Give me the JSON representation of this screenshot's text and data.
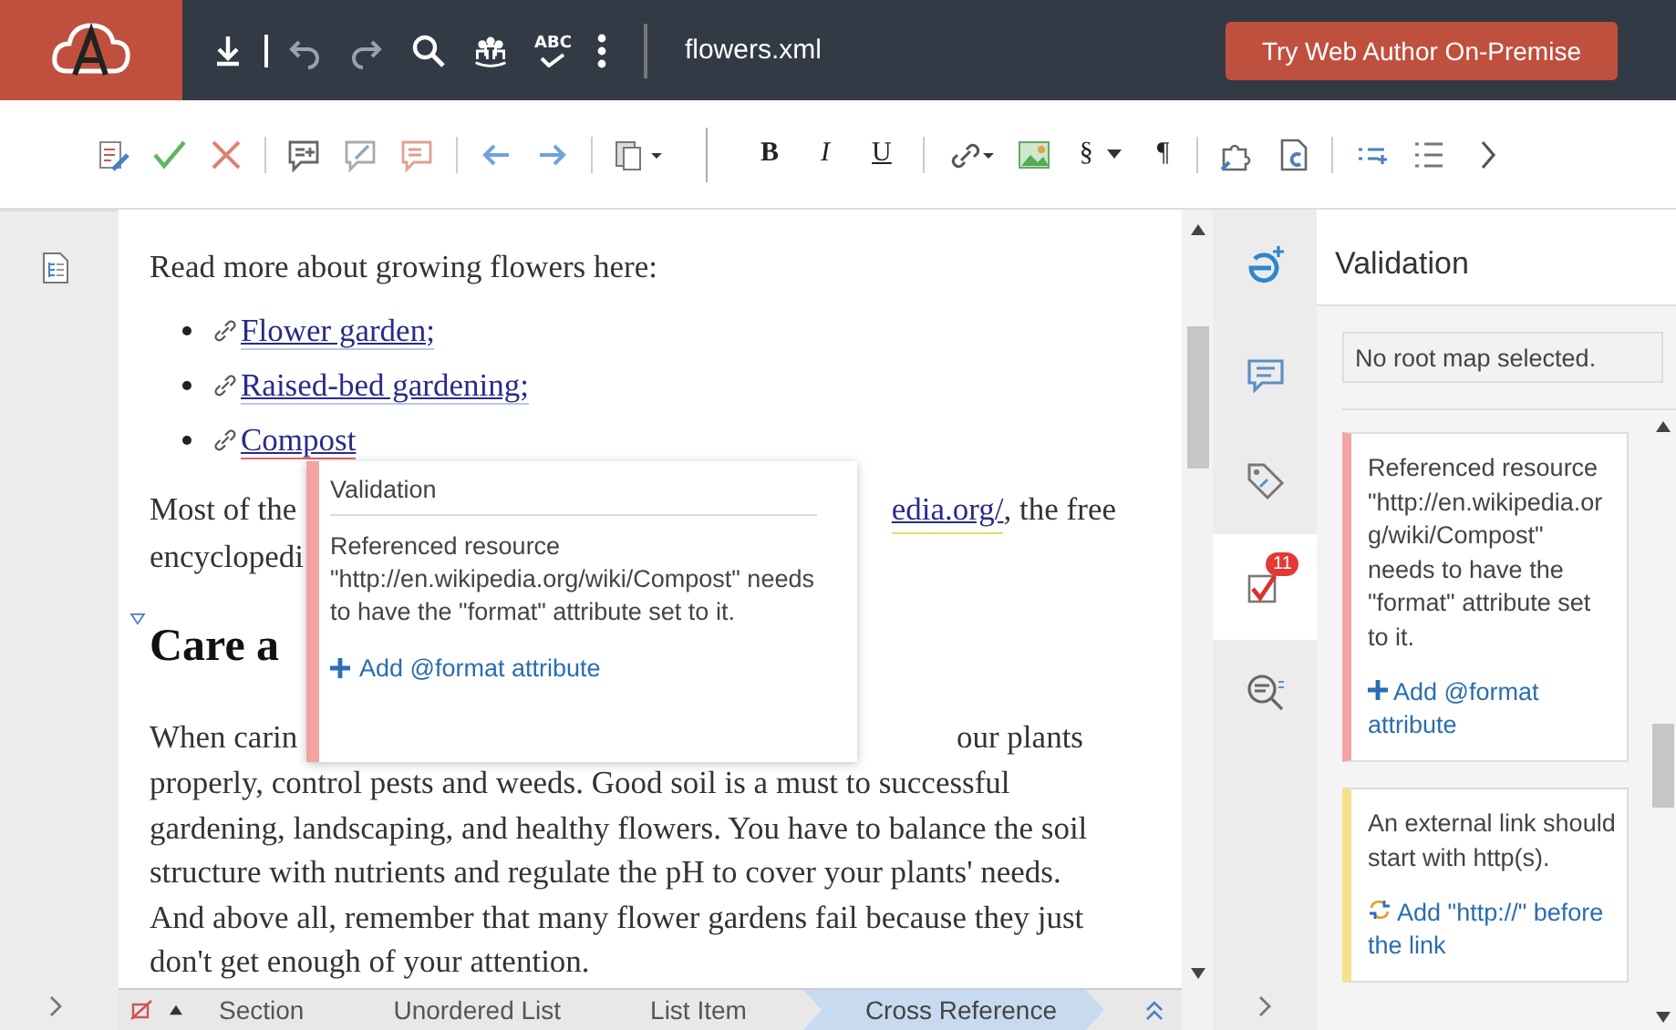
{
  "top_bar": {
    "spell_label": "ABC",
    "file_name": "flowers.xml",
    "try_button": "Try Web Author On-Premise"
  },
  "toolbar": {
    "format_buttons": [
      {
        "label": "B",
        "kind": "bold"
      },
      {
        "label": "I",
        "kind": "italic"
      },
      {
        "label": "U",
        "kind": "underline"
      }
    ],
    "section_label": "§",
    "pilcrow_label": "¶"
  },
  "document": {
    "intro": "Read more about growing flowers here:",
    "links": [
      {
        "label": "Flower garden;",
        "error": false
      },
      {
        "label": "Raised-bed gardening;",
        "error": false
      },
      {
        "label": "Compost",
        "error": true
      }
    ],
    "paragraph_left": [
      "Most of the",
      "encyclopedi"
    ],
    "paragraph_link": "edia.org/",
    "paragraph_right": ", the free",
    "heading": "Care a",
    "care_first_left": "When carin",
    "care_first_right": "our plants",
    "care_lines": [
      "properly, control pests and weeds. Good soil is a must to successful",
      "gardening, landscaping, and healthy flowers. You have to balance the soil",
      "structure with nutrients and regulate the pH to cover your plants' needs.",
      "And above all, remember that many flower gardens fail because they just",
      "don't get enough of your attention."
    ]
  },
  "popup": {
    "title": "Validation",
    "message": "Referenced resource \"http://en.wikipedia.org/wiki/Compost\" needs to have the \"format\" attribute set to it.",
    "action": "Add @format attribute",
    "color": "#f4a3a3"
  },
  "breadcrumb": [
    {
      "label": "Section",
      "selected": false
    },
    {
      "label": "Unordered List",
      "selected": false
    },
    {
      "label": "List Item",
      "selected": false
    },
    {
      "label": "Cross Reference",
      "selected": true
    }
  ],
  "side_tabs": [
    {
      "kind": "add",
      "selected": false
    },
    {
      "kind": "comments",
      "selected": false
    },
    {
      "kind": "tags",
      "selected": false
    },
    {
      "kind": "validation",
      "selected": true,
      "badge": "11"
    },
    {
      "kind": "find",
      "selected": false
    }
  ],
  "validation_panel": {
    "title": "Validation",
    "root_map_field": {
      "value": "No root map selected."
    },
    "messages": [
      {
        "color": "#f4a3a3",
        "text": "Referenced resource \"http://en.wikipedia.org/wiki/Compost\" needs to have the \"format\" attribute set to it.",
        "action": "Add @format attribute",
        "kind": "add"
      },
      {
        "color": "#f7e08a",
        "text": "An external link should start with http(s).",
        "action": "Add \"http://\" before the link",
        "kind": "replace"
      }
    ]
  }
}
